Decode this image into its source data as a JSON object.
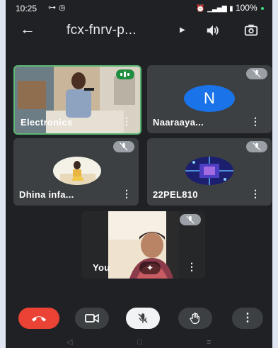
{
  "status_bar": {
    "time": "10:25",
    "battery": "100%"
  },
  "header": {
    "meeting_code": "fcx-fnrv-p..."
  },
  "tiles": [
    {
      "name": "Electronics"
    },
    {
      "name": "Naaraaya...",
      "avatar_letter": "N"
    },
    {
      "name": "Dhina infa..."
    },
    {
      "name": "22PEL810"
    },
    {
      "name": "You"
    }
  ],
  "controls": {
    "more_symbol": "⋮"
  },
  "colors": {
    "background": "#202124",
    "tile": "#3c4043",
    "active_speaker_border": "#5bb974",
    "hangup": "#ea4335",
    "avatar_blue": "#1a73e8"
  }
}
